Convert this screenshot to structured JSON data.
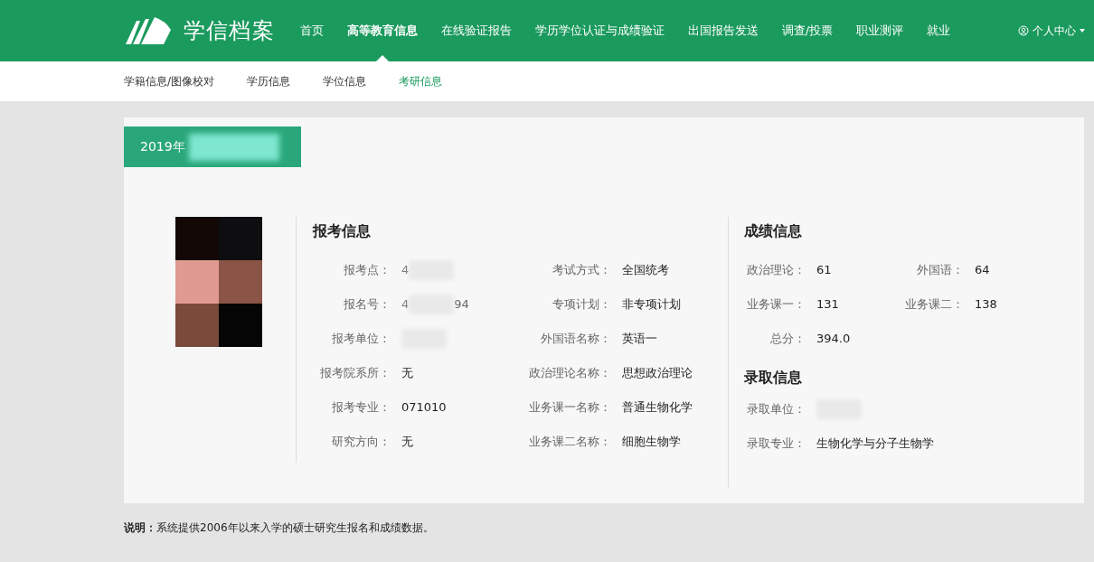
{
  "brand": {
    "name": "学信档案"
  },
  "nav": [
    {
      "label": "首页",
      "selected": false
    },
    {
      "label": "高等教育信息",
      "selected": true
    },
    {
      "label": "在线验证报告",
      "selected": false
    },
    {
      "label": "学历学位认证与成绩验证",
      "selected": false
    },
    {
      "label": "出国报告发送",
      "selected": false
    },
    {
      "label": "调查/投票",
      "selected": false
    },
    {
      "label": "职业测评",
      "selected": false
    },
    {
      "label": "就业",
      "selected": false
    }
  ],
  "user_menu": {
    "label": "个人中心"
  },
  "subnav": [
    {
      "label": "学籍信息/图像校对",
      "selected": false
    },
    {
      "label": "学历信息",
      "selected": false
    },
    {
      "label": "学位信息",
      "selected": false
    },
    {
      "label": "考研信息",
      "selected": true
    }
  ],
  "record_tab": {
    "title": "2019年",
    "redacted": true
  },
  "application": {
    "heading": "报考信息",
    "fields": [
      {
        "label": "报考点：",
        "value": "4",
        "redacted": true
      },
      {
        "label": "考试方式：",
        "value": "全国统考",
        "redacted": false
      },
      {
        "label": "报名号：",
        "value": "4",
        "tail": "94",
        "redacted": true
      },
      {
        "label": "专项计划：",
        "value": "非专项计划",
        "redacted": false
      },
      {
        "label": "报考单位：",
        "redacted": true
      },
      {
        "label": "外国语名称：",
        "value": "英语一",
        "redacted": false
      },
      {
        "label": "报考院系所：",
        "value": "无",
        "redacted": false
      },
      {
        "label": "政治理论名称：",
        "value": "思想政治理论",
        "redacted": false
      },
      {
        "label": "报考专业：",
        "value": "071010",
        "redacted": false
      },
      {
        "label": "业务课一名称：",
        "value": "普通生物化学",
        "redacted": false
      },
      {
        "label": "研究方向：",
        "value": "无",
        "redacted": false
      },
      {
        "label": "业务课二名称：",
        "value": "细胞生物学",
        "redacted": false
      }
    ]
  },
  "scores": {
    "heading": "成绩信息",
    "fields": [
      {
        "label": "政治理论：",
        "value": "61"
      },
      {
        "label": "外国语：",
        "value": "64"
      },
      {
        "label": "业务课一：",
        "value": "131"
      },
      {
        "label": "业务课二：",
        "value": "138"
      },
      {
        "label": "总分：",
        "value": "394.0"
      }
    ]
  },
  "admission": {
    "heading": "录取信息",
    "fields": [
      {
        "label": "录取单位：",
        "redacted": true
      },
      {
        "label": "录取专业：",
        "value": "生物化学与分子生物学",
        "redacted": false
      }
    ]
  },
  "note": {
    "label": "说明：",
    "text": "系统提供2006年以来入学的硕士研究生报名和成绩数据。"
  }
}
